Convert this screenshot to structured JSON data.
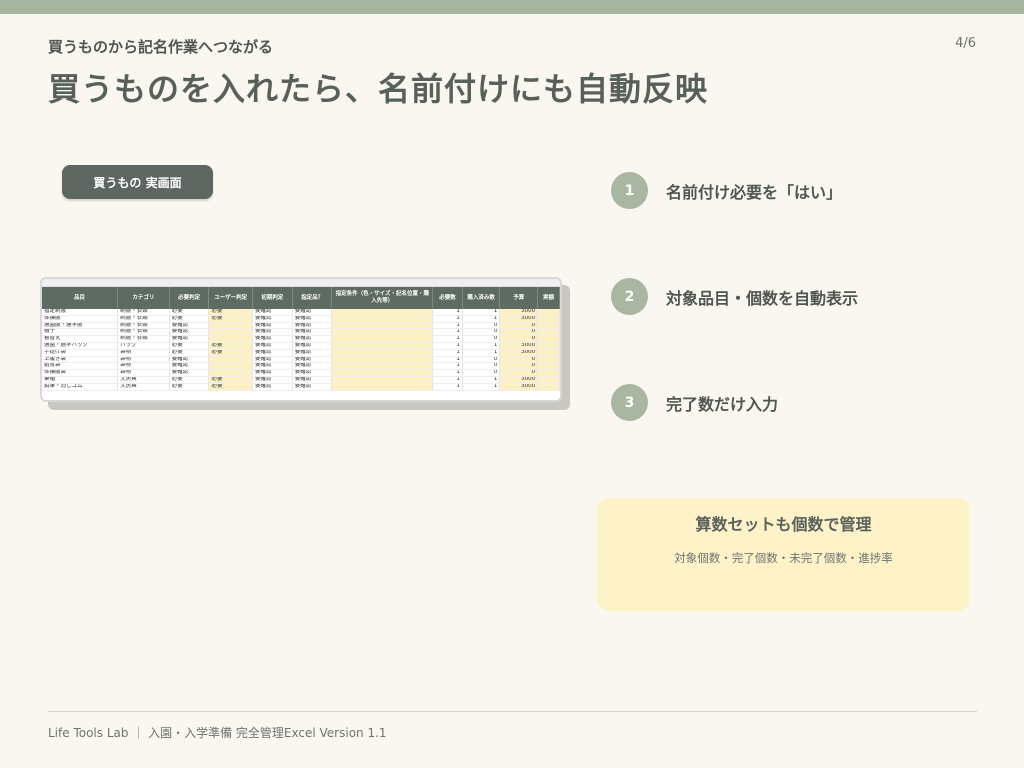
{
  "header": {
    "kicker": "買うものから記名作業へつながる",
    "page": "4/6",
    "title": "買うものを入れたら、名前付けにも自動反映"
  },
  "pill_label": "買うもの 実画面",
  "sheet": {
    "headers": [
      "品目",
      "カテゴリ",
      "必要判定",
      "ユーザー判定",
      "初期判定",
      "指定品？",
      "指定条件（色・サイズ・記名位置・購入先等）",
      "必要数",
      "購入済み数",
      "予算",
      "実額"
    ],
    "rows": [
      [
        "指定制服",
        "制服・衣類",
        "必要",
        "必要",
        "要確認",
        "要確認",
        "",
        "1",
        "1",
        "3000",
        ""
      ],
      [
        "体操服",
        "制服・衣類",
        "必要",
        "必要",
        "要確認",
        "要確認",
        "",
        "1",
        "1",
        "3000",
        ""
      ],
      [
        "通園服・通学服",
        "制服・衣類",
        "要確認",
        "",
        "要確認",
        "要確認",
        "",
        "1",
        "0",
        "0",
        ""
      ],
      [
        "帽子",
        "制服・衣類",
        "要確認",
        "",
        "要確認",
        "要確認",
        "",
        "1",
        "0",
        "0",
        ""
      ],
      [
        "着替え",
        "制服・衣類",
        "要確認",
        "",
        "要確認",
        "要確認",
        "",
        "1",
        "0",
        "0",
        ""
      ],
      [
        "通園・通学バッグ",
        "バッグ",
        "必要",
        "必要",
        "要確認",
        "要確認",
        "",
        "1",
        "1",
        "3000",
        ""
      ],
      [
        "手提げ袋",
        "袋物",
        "必要",
        "必要",
        "要確認",
        "要確認",
        "",
        "1",
        "1",
        "3000",
        ""
      ],
      [
        "上履き袋",
        "袋物",
        "要確認",
        "",
        "要確認",
        "要確認",
        "",
        "1",
        "0",
        "0",
        ""
      ],
      [
        "給食袋",
        "袋物",
        "要確認",
        "",
        "要確認",
        "要確認",
        "",
        "1",
        "0",
        "0",
        ""
      ],
      [
        "体操服袋",
        "袋物",
        "要確認",
        "",
        "要確認",
        "要確認",
        "",
        "1",
        "0",
        "0",
        ""
      ],
      [
        "筆箱",
        "文房具",
        "必要",
        "必要",
        "要確認",
        "要確認",
        "",
        "1",
        "1",
        "3000",
        ""
      ],
      [
        "鉛筆・消しゴム",
        "文房具",
        "必要",
        "必要",
        "要確認",
        "要確認",
        "",
        "1",
        "1",
        "3000",
        ""
      ]
    ]
  },
  "steps": [
    {
      "num": "1",
      "label": "名前付け必要を「はい」"
    },
    {
      "num": "2",
      "label": "対象品目・個数を自動表示"
    },
    {
      "num": "3",
      "label": "完了数だけ入力"
    }
  ],
  "note": {
    "title": "算数セットも個数で管理",
    "sub": "対象個数・完了個数・未完了個数・進捗率"
  },
  "footer": "Life Tools Lab ｜ 入園・入学準備 完全管理Excel  Version 1.1",
  "colors": {
    "accent_green": "#a9b6a2",
    "dark_pill": "#5d6660",
    "note_bg": "#fdf2c8",
    "background": "#faf7f0"
  }
}
